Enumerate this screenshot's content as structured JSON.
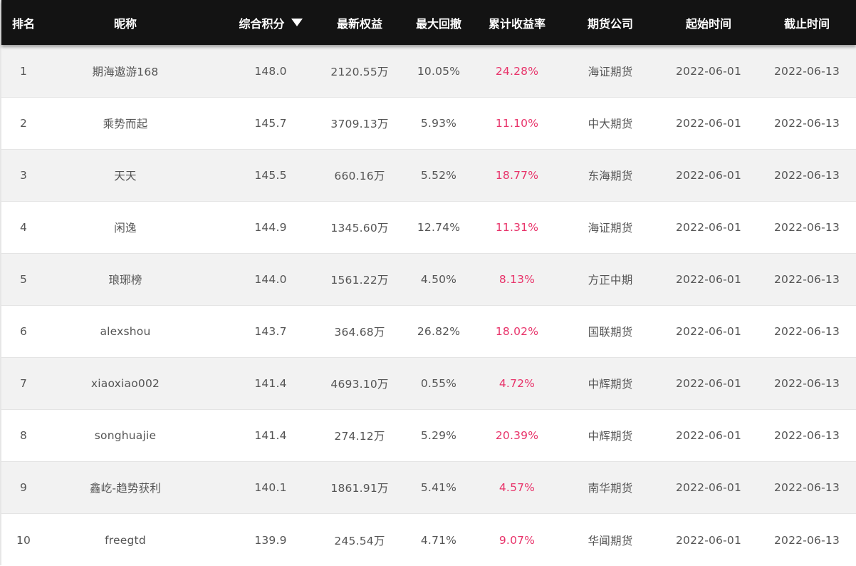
{
  "colors": {
    "header_bg": "#131313",
    "header_text": "#ffffff",
    "row_odd_bg": "#f2f2f2",
    "row_even_bg": "#ffffff",
    "return_text": "#e8336a",
    "body_text": "#555555"
  },
  "header": {
    "rank": "排名",
    "nickname": "昵称",
    "score": "综合积分",
    "score_sort_icon": "sort-desc-triangle",
    "equity": "最新权益",
    "max_drawdown": "最大回撤",
    "cum_return": "累计收益率",
    "company": "期货公司",
    "start_time": "起始时间",
    "end_time": "截止时间"
  },
  "rows": [
    {
      "rank": "1",
      "nickname": "期海遨游168",
      "score": "148.0",
      "equity": "2120.55万",
      "max_drawdown": "10.05%",
      "cum_return": "24.28%",
      "company": "海证期货",
      "start_time": "2022-06-01",
      "end_time": "2022-06-13"
    },
    {
      "rank": "2",
      "nickname": "乘势而起",
      "score": "145.7",
      "equity": "3709.13万",
      "max_drawdown": "5.93%",
      "cum_return": "11.10%",
      "company": "中大期货",
      "start_time": "2022-06-01",
      "end_time": "2022-06-13"
    },
    {
      "rank": "3",
      "nickname": "天天",
      "score": "145.5",
      "equity": "660.16万",
      "max_drawdown": "5.52%",
      "cum_return": "18.77%",
      "company": "东海期货",
      "start_time": "2022-06-01",
      "end_time": "2022-06-13"
    },
    {
      "rank": "4",
      "nickname": "闲逸",
      "score": "144.9",
      "equity": "1345.60万",
      "max_drawdown": "12.74%",
      "cum_return": "11.31%",
      "company": "海证期货",
      "start_time": "2022-06-01",
      "end_time": "2022-06-13"
    },
    {
      "rank": "5",
      "nickname": "琅琊榜",
      "score": "144.0",
      "equity": "1561.22万",
      "max_drawdown": "4.50%",
      "cum_return": "8.13%",
      "company": "方正中期",
      "start_time": "2022-06-01",
      "end_time": "2022-06-13"
    },
    {
      "rank": "6",
      "nickname": "alexshou",
      "score": "143.7",
      "equity": "364.68万",
      "max_drawdown": "26.82%",
      "cum_return": "18.02%",
      "company": "国联期货",
      "start_time": "2022-06-01",
      "end_time": "2022-06-13"
    },
    {
      "rank": "7",
      "nickname": "xiaoxiao002",
      "score": "141.4",
      "equity": "4693.10万",
      "max_drawdown": "0.55%",
      "cum_return": "4.72%",
      "company": "中辉期货",
      "start_time": "2022-06-01",
      "end_time": "2022-06-13"
    },
    {
      "rank": "8",
      "nickname": "songhuajie",
      "score": "141.4",
      "equity": "274.12万",
      "max_drawdown": "5.29%",
      "cum_return": "20.39%",
      "company": "中辉期货",
      "start_time": "2022-06-01",
      "end_time": "2022-06-13"
    },
    {
      "rank": "9",
      "nickname": "鑫屹-趋势获利",
      "score": "140.1",
      "equity": "1861.91万",
      "max_drawdown": "5.41%",
      "cum_return": "4.57%",
      "company": "南华期货",
      "start_time": "2022-06-01",
      "end_time": "2022-06-13"
    },
    {
      "rank": "10",
      "nickname": "freegtd",
      "score": "139.9",
      "equity": "245.54万",
      "max_drawdown": "4.71%",
      "cum_return": "9.07%",
      "company": "华闻期货",
      "start_time": "2022-06-01",
      "end_time": "2022-06-13"
    }
  ]
}
